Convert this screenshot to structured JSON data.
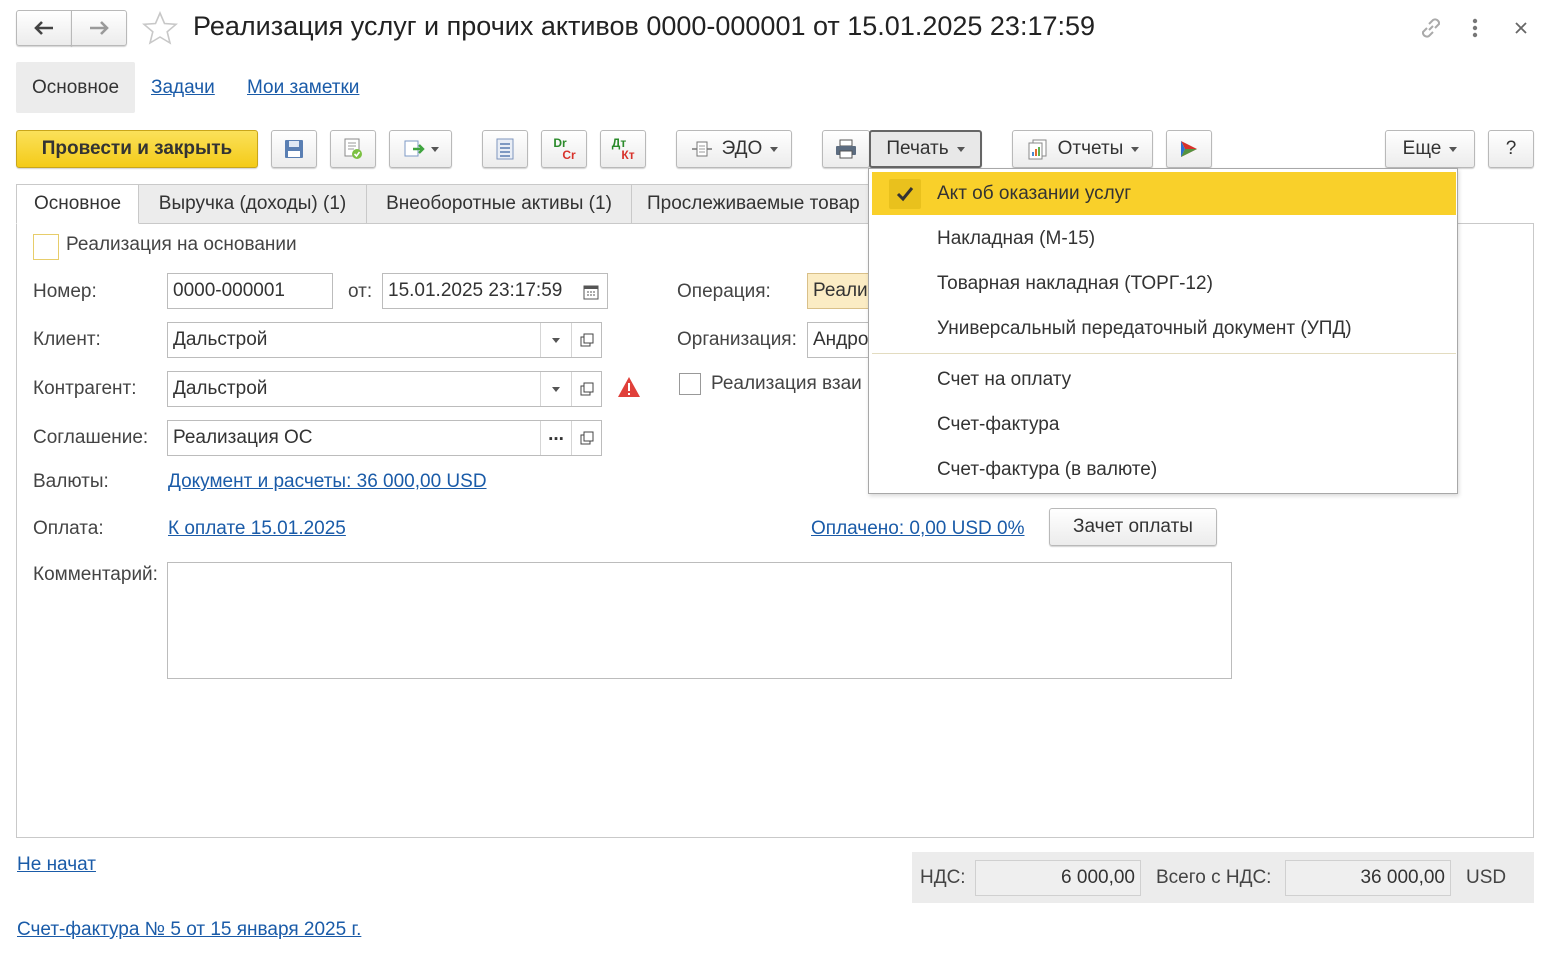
{
  "window": {
    "title": "Реализация услуг и прочих активов 0000-000001 от 15.01.2025 23:17:59"
  },
  "nav_tabs": [
    "Основное",
    "Задачи",
    "Мои заметки"
  ],
  "toolbar": {
    "post_close": "Провести и закрыть",
    "edo": "ЭДО",
    "print": "Печать",
    "reports": "Отчеты",
    "more": "Еще",
    "help": "?",
    "drcr_top": "Dr",
    "drcr_bottom": "Cr",
    "dtkt_top": "Дт",
    "dtkt_bottom": "Кт"
  },
  "form_tabs": [
    "Основное",
    "Выручка (доходы) (1)",
    "Внеоборотные активы (1)",
    "Прослеживаемые товар"
  ],
  "form": {
    "based_on_label": "Реализация на основании",
    "number_label": "Номер:",
    "number_value": "0000-000001",
    "from_label": "от:",
    "date_value": "15.01.2025 23:17:59",
    "operation_label": "Операция:",
    "operation_value": "Реали",
    "client_label": "Клиент:",
    "client_value": "Дальстрой",
    "organization_label": "Организация:",
    "organization_value": "Андро",
    "counterparty_label": "Контрагент:",
    "counterparty_value": "Дальстрой",
    "mutual_label": "Реализация взаи",
    "agreement_label": "Соглашение:",
    "agreement_value": "Реализация ОС",
    "ellipsis": "...",
    "currency_label": "Валюты:",
    "currency_link": "Документ и расчеты: 36 000,00 USD",
    "payment_label": "Оплата:",
    "payment_link": "К оплате 15.01.2025",
    "paid_link": "Оплачено: 0,00 USD 0%",
    "offset_button": "Зачет оплаты",
    "comment_label": "Комментарий:"
  },
  "print_menu": {
    "items": [
      "Акт об оказании услуг",
      "Накладная (М-15)",
      "Товарная накладная (ТОРГ-12)",
      "Универсальный передаточный документ (УПД)",
      "Счет на оплату",
      "Счет-фактура",
      "Счет-фактура (в валюте)"
    ],
    "selected_index": 0,
    "highlight_color": "#f9d02a"
  },
  "footer": {
    "status_link": "Не начат",
    "vat_label": "НДС:",
    "vat_value": "6 000,00",
    "total_label": "Всего с НДС:",
    "total_value": "36 000,00",
    "currency": "USD",
    "invoice_link": "Счет-фактура № 5 от 15 января 2025 г."
  },
  "colors": {
    "primary_button": "#f8d52c",
    "link": "#1a5ba8",
    "warning": "#e0403a",
    "operation_field": "#fbecc4"
  }
}
